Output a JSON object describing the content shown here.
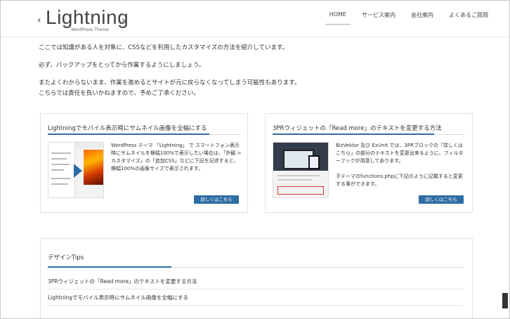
{
  "header": {
    "logo": {
      "bracket_left": "‹",
      "word": "Lightning",
      "bracket_right": "›",
      "subtitle": "WordPress Theme"
    },
    "nav": [
      {
        "label": "HOME",
        "active": true
      },
      {
        "label": "サービス案内",
        "active": false
      },
      {
        "label": "会社案内",
        "active": false
      },
      {
        "label": "よくあるご質問",
        "active": false
      }
    ]
  },
  "intro": {
    "line1": "ここでは知識がある人を対象に、CSSなどを利用したカスタマイズの方法を紹介しています。",
    "line2": "必ず、バックアップをとってから作業するようにしましょう。",
    "line3": "またよくわからないまま、作業を進めるとサイトが元に戻らなくなってしまう可能性もあります。",
    "line4": "こちらでは責任を負いかねますので、予めご了承ください。"
  },
  "cards": [
    {
      "title": "Lightningでモバイル表示時にサムネイル画像を全幅にする",
      "text1": "WordPress テーマ 「Lightning」 で スマートフォン表示時にサムネイルを横幅100%で表示したい場合は、「外観 > カスタマイズ」の「追加CSS」などに下記を記述すると、横幅100%の画像サイズで表示されます。",
      "text2": "",
      "button": "詳しくはこちら"
    },
    {
      "title": "3PRウィジェットの「Read more」のテキストを変更する方法",
      "text1": "BizVektor 及び ExUnit では、3PRブロックの「詳しくはこちら」の部分のテキストを変更出来るように、フィルターフックが用意してあります。",
      "text2": "子テーマのfunctions.phpに下記のように記載すると変更する事ができます。",
      "button": "詳しくはこちら"
    }
  ],
  "tips": {
    "title": "デザインTips",
    "items": [
      "3PRウィジェットの「Read more」のテキストを変更する方法",
      "Lightningでモバイル表示時にサムネイル画像を全幅にする"
    ]
  },
  "colors": {
    "accent": "#2e6da4",
    "border": "#e2e2e2"
  }
}
